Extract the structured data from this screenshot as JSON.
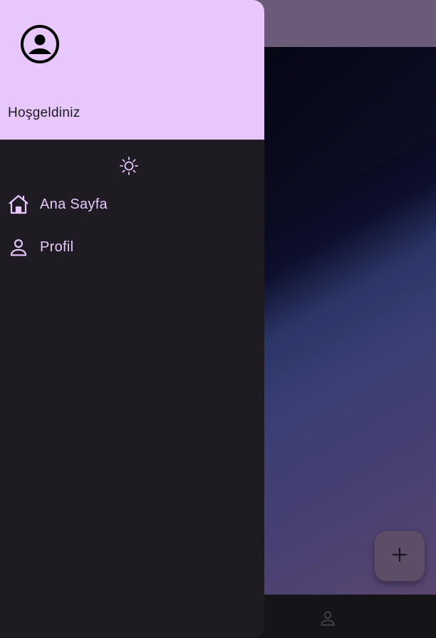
{
  "drawer": {
    "header": {
      "title": "Hoşgeldiniz",
      "avatar_icon": "account-circle-icon"
    },
    "theme_toggle_icon": "sun-icon",
    "items": [
      {
        "label": "Ana Sayfa",
        "icon": "home-icon"
      },
      {
        "label": "Profil",
        "icon": "person-icon"
      }
    ]
  },
  "background_app": {
    "fab_icon": "add-icon",
    "bottom_nav_icon": "person-icon"
  },
  "colors": {
    "accent": "#e8c8fc",
    "drawer_bg": "#1e1c22",
    "app_bar": "#6b5a78",
    "fab_bg": "#5e4d66",
    "bottom_nav_bg": "#151419"
  }
}
